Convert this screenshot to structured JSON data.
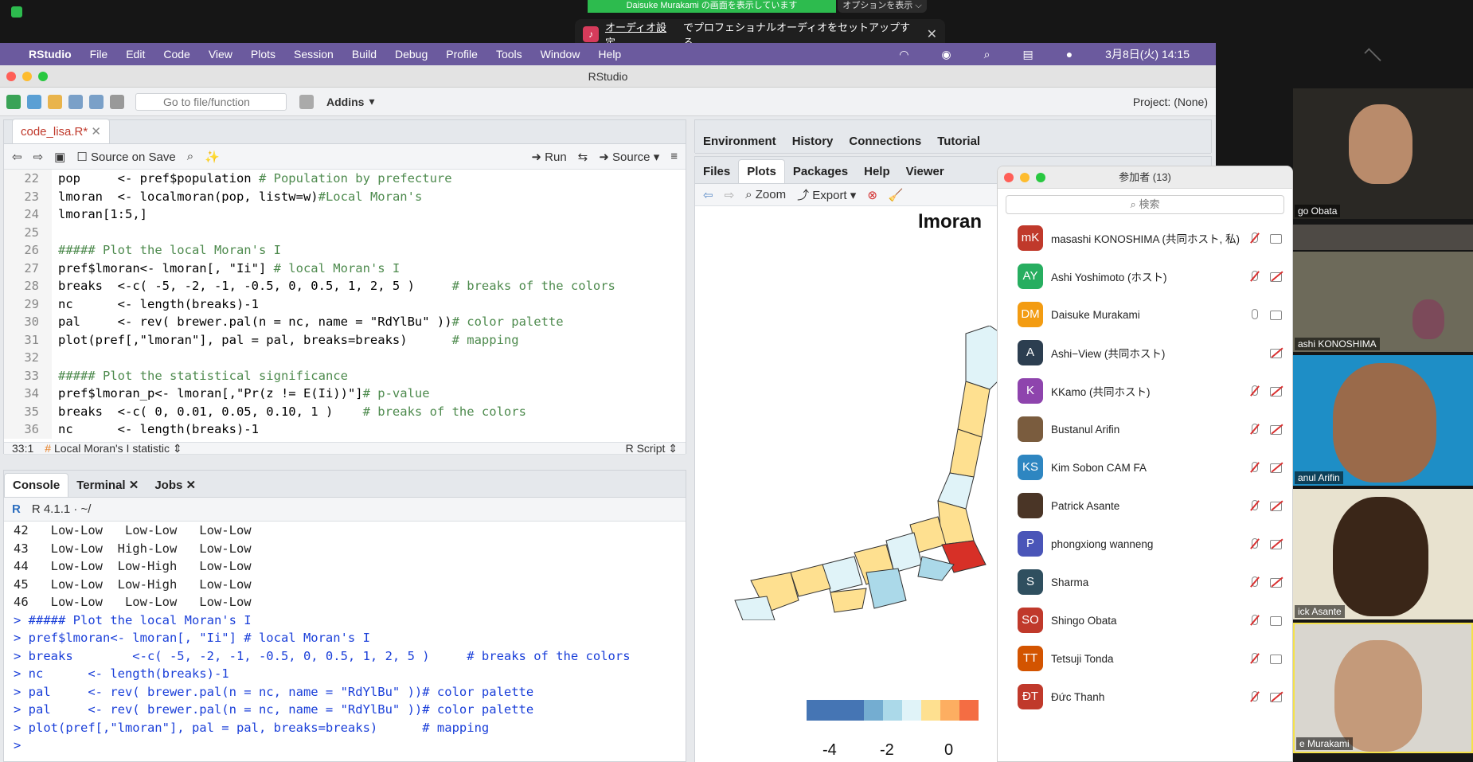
{
  "zoom_top": {
    "share_banner": "Daisuke Murakami の画面を表示しています",
    "options_label": "オプションを表示 ⌵",
    "audio_toast": {
      "link": "オーディオ設定",
      "text": "でプロフェショナルオーディオをセットアップする",
      "close": "✕"
    }
  },
  "menubar": {
    "apple": "",
    "app": "RStudio",
    "items": [
      "File",
      "Edit",
      "Code",
      "View",
      "Plots",
      "Session",
      "Build",
      "Debug",
      "Profile",
      "Tools",
      "Window",
      "Help"
    ],
    "clock": "3月8日(火) 14:15"
  },
  "window": {
    "title": "RStudio"
  },
  "toolbar": {
    "goto_placeholder": "Go to file/function",
    "addins": "Addins",
    "project": "Project: (None)"
  },
  "editor": {
    "tab_label": "code_lisa.R*",
    "source_on_save": "Source on Save",
    "run_label": "Run",
    "source_label": "Source",
    "status_pos": "33:1",
    "status_section": "Local Moran's I statistic",
    "status_type": "R Script",
    "lines": [
      {
        "n": "22",
        "code": "pop     <- pref$population ",
        "comment": "# Population by prefecture"
      },
      {
        "n": "23",
        "code": "lmoran  <- localmoran(pop, listw=w)",
        "comment": "#Local Moran's"
      },
      {
        "n": "24",
        "code": "lmoran[1:5,]",
        "comment": ""
      },
      {
        "n": "25",
        "code": "",
        "comment": ""
      },
      {
        "n": "26",
        "code": "",
        "comment": "##### Plot the local Moran's I"
      },
      {
        "n": "27",
        "code": "pref$lmoran<- lmoran[, \"Ii\"] ",
        "comment": "# local Moran's I"
      },
      {
        "n": "28",
        "code": "breaks  <-c( -5, -2, -1, -0.5, 0, 0.5, 1, 2, 5 )     ",
        "comment": "# breaks of the colors"
      },
      {
        "n": "29",
        "code": "nc      <- length(breaks)-1",
        "comment": ""
      },
      {
        "n": "30",
        "code": "pal     <- rev( brewer.pal(n = nc, name = \"RdYlBu\" ))",
        "comment": "# color palette"
      },
      {
        "n": "31",
        "code": "plot(pref[,\"lmoran\"], pal = pal, breaks=breaks)      ",
        "comment": "# mapping"
      },
      {
        "n": "32",
        "code": "",
        "comment": ""
      },
      {
        "n": "33",
        "code": "",
        "comment": "##### Plot the statistical significance"
      },
      {
        "n": "34",
        "code": "pref$lmoran_p<- lmoran[,\"Pr(z != E(Ii))\"]",
        "comment": "# p-value"
      },
      {
        "n": "35",
        "code": "breaks  <-c( 0, 0.01, 0.05, 0.10, 1 )    ",
        "comment": "# breaks of the colors"
      },
      {
        "n": "36",
        "code": "nc      <- length(breaks)-1",
        "comment": ""
      }
    ]
  },
  "console": {
    "tabs": [
      "Console",
      "Terminal",
      "Jobs"
    ],
    "version": "R 4.1.1 · ~/",
    "output": [
      "42   Low-Low   Low-Low   Low-Low",
      "43   Low-Low  High-Low   Low-Low",
      "44   Low-Low  Low-High   Low-Low",
      "45   Low-Low  Low-High   Low-Low",
      "46   Low-Low   Low-Low   Low-Low"
    ],
    "input": [
      "> ##### Plot the local Moran's I",
      "> pref$lmoran<- lmoran[, \"Ii\"] # local Moran's I",
      "> breaks        <-c( -5, -2, -1, -0.5, 0, 0.5, 1, 2, 5 )     # breaks of the colors",
      "> nc      <- length(breaks)-1",
      "> pal     <- rev( brewer.pal(n = nc, name = \"RdYlBu\" ))# color palette",
      "> pal     <- rev( brewer.pal(n = nc, name = \"RdYlBu\" ))# color palette",
      "> plot(pref[,\"lmoran\"], pal = pal, breaks=breaks)      # mapping",
      ">"
    ]
  },
  "env_pane": {
    "tabs": [
      "Environment",
      "History",
      "Connections",
      "Tutorial"
    ]
  },
  "plots_pane": {
    "tabs": [
      "Files",
      "Plots",
      "Packages",
      "Help",
      "Viewer"
    ],
    "zoom": "Zoom",
    "export": "Export",
    "plot_title": "lmoran",
    "legend_ticks": [
      "-4",
      "-2",
      "0"
    ],
    "legend_colors": [
      "#4575b4",
      "#4575b4",
      "#4575b4",
      "#74add1",
      "#abd9e9",
      "#e0f3f8",
      "#fee090",
      "#fdae61",
      "#f46d43"
    ]
  },
  "participants": {
    "title": "参加者 (13)",
    "search": "検索",
    "list": [
      {
        "initials": "mK",
        "name": "masashi KONOSHIMA (共同ホスト, 私)",
        "color": "#c0392b",
        "mic": "off",
        "video": "on"
      },
      {
        "initials": "AY",
        "name": "Ashi Yoshimoto (ホスト)",
        "color": "#27ae60",
        "mic": "off",
        "video": "off"
      },
      {
        "initials": "DM",
        "name": "Daisuke Murakami",
        "color": "#f39c12",
        "mic": "on",
        "video": "on"
      },
      {
        "initials": "A",
        "name": "Ashi−View (共同ホスト)",
        "color": "#2c3e50",
        "mic": "none",
        "video": "off"
      },
      {
        "initials": "K",
        "name": "KKamo (共同ホスト)",
        "color": "#8e44ad",
        "mic": "off",
        "video": "off"
      },
      {
        "initials": "",
        "name": "Bustanul Arifin",
        "color": "#7a5c3e",
        "mic": "off",
        "video": "off"
      },
      {
        "initials": "KS",
        "name": "Kim Sobon CAM FA",
        "color": "#2e86c1",
        "mic": "off",
        "video": "off"
      },
      {
        "initials": "",
        "name": "Patrick Asante",
        "color": "#4a3526",
        "mic": "off",
        "video": "off"
      },
      {
        "initials": "P",
        "name": "phongxiong wanneng",
        "color": "#4a55b8",
        "mic": "off",
        "video": "off"
      },
      {
        "initials": "S",
        "name": "Sharma",
        "color": "#2f4f5f",
        "mic": "off",
        "video": "off"
      },
      {
        "initials": "SO",
        "name": "Shingo Obata",
        "color": "#c0392b",
        "mic": "off",
        "video": "on"
      },
      {
        "initials": "TT",
        "name": "Tetsuji Tonda",
        "color": "#d35400",
        "mic": "off",
        "video": "on"
      },
      {
        "initials": "ĐT",
        "name": "Đức Thanh",
        "color": "#c0392b",
        "mic": "off",
        "video": "off"
      }
    ]
  },
  "videos": [
    {
      "label": "go Obata"
    },
    {
      "label": "ashi KONOSHIMA"
    },
    {
      "label": "anul Arifin"
    },
    {
      "label": "ick Asante"
    },
    {
      "label": "e Murakami"
    }
  ]
}
